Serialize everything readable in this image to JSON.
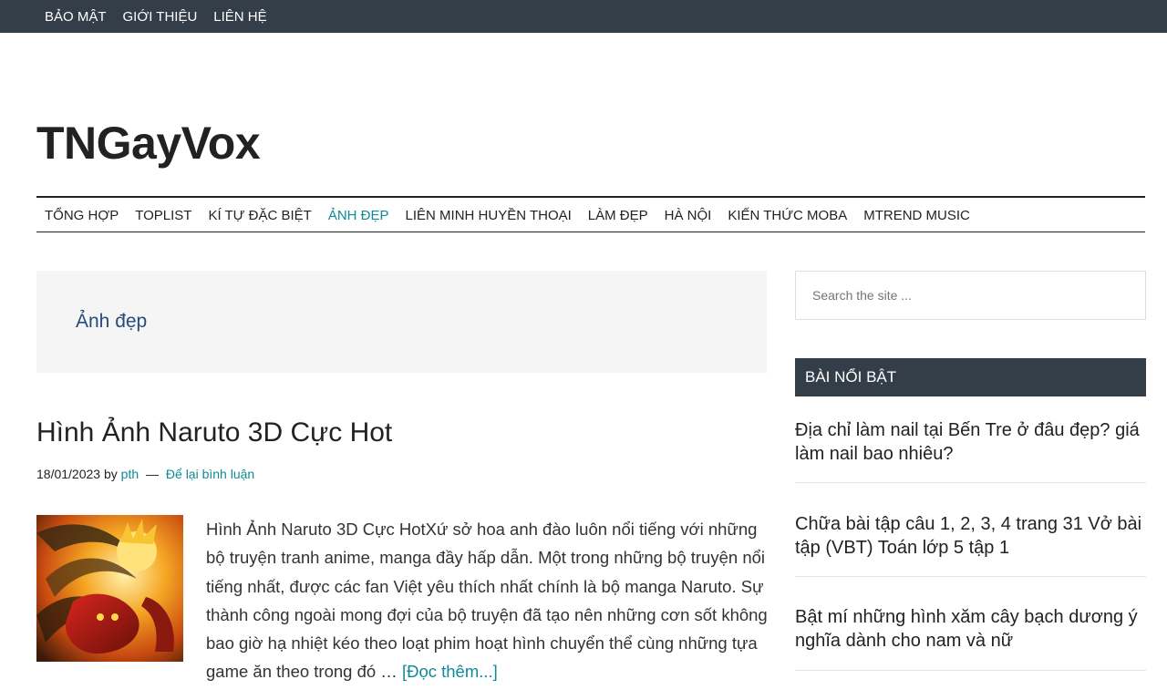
{
  "topbar": {
    "items": [
      "BẢO MẬT",
      "GIỚI THIỆU",
      "LIÊN HỆ"
    ]
  },
  "site": {
    "title": "TNGayVox"
  },
  "primary_nav": {
    "items": [
      "TỔNG HỢP",
      "TOPLIST",
      "KÍ TỰ ĐẶC BIỆT",
      "ẢNH ĐẸP",
      "LIÊN MINH HUYỀN THOẠI",
      "LÀM ĐẸP",
      "HÀ NỘI",
      "KIẾN THỨC MOBA",
      "MTREND MUSIC"
    ],
    "active_index": 3
  },
  "archive": {
    "title": "Ảnh đẹp"
  },
  "post": {
    "title": "Hình Ảnh Naruto 3D Cực Hot",
    "date": "18/01/2023",
    "by": "by",
    "author": "pth",
    "separator": "—",
    "comment_link": "Để lại bình luận",
    "excerpt": "Hình Ảnh Naruto 3D Cực HotXứ sở hoa anh đào luôn nổi tiếng với những bộ truyện tranh anime, manga đầy hấp dẫn. Một trong những bộ truyện nổi tiếng nhất, được các fan Việt yêu thích nhất chính là bộ manga Naruto. Sự thành công ngoài mong đợi của bộ truyện đã tạo nên những cơn sốt không bao giờ hạ nhiệt kéo theo loạt phim hoạt hình chuyển thể cùng những tựa game ăn theo trong đó …",
    "read_more": "[Đọc thêm...]"
  },
  "sidebar": {
    "search_placeholder": "Search the site ...",
    "widget_title": "BÀI NỔI BẬT",
    "featured": [
      "Địa chỉ làm nail tại Bến Tre ở đâu đẹp? giá làm nail bao nhiêu?",
      "Chữa bài tập câu 1, 2, 3, 4 trang 31 Vở bài tập (VBT) Toán lớp 5 tập 1",
      "Bật mí những hình xăm cây bạch dương ý nghĩa dành cho nam và nữ"
    ]
  },
  "colors": {
    "topbar_bg": "#333e48",
    "accent": "#0e8a96",
    "archive_title": "#274b7a"
  }
}
